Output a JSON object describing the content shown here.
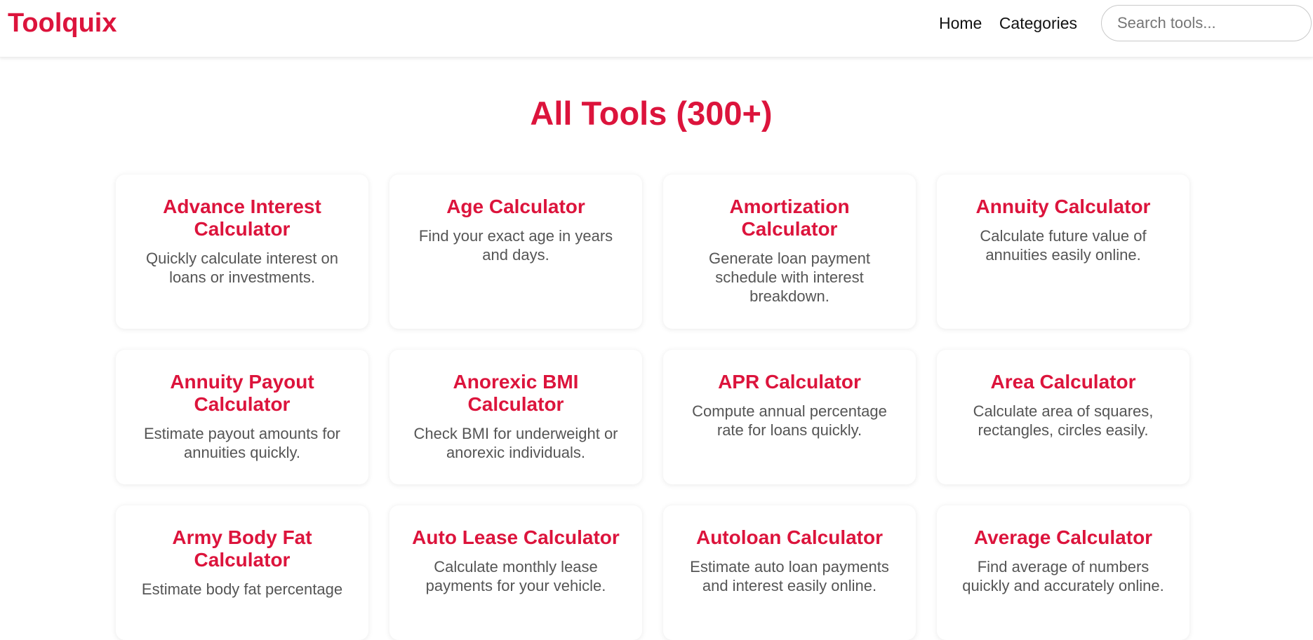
{
  "header": {
    "logo": "Toolquix",
    "nav": [
      {
        "label": "Home"
      },
      {
        "label": "Categories"
      }
    ],
    "search": {
      "placeholder": "Search tools...",
      "value": ""
    }
  },
  "main": {
    "title": "All Tools (300+)",
    "tools": [
      {
        "title": "Advance Interest Calculator",
        "desc": "Quickly calculate interest on loans or investments."
      },
      {
        "title": "Age Calculator",
        "desc": "Find your exact age in years and days."
      },
      {
        "title": "Amortization Calculator",
        "desc": "Generate loan payment schedule with interest breakdown."
      },
      {
        "title": "Annuity Calculator",
        "desc": "Calculate future value of annuities easily online."
      },
      {
        "title": "Annuity Payout Calculator",
        "desc": "Estimate payout amounts for annuities quickly."
      },
      {
        "title": "Anorexic BMI Calculator",
        "desc": "Check BMI for underweight or anorexic individuals."
      },
      {
        "title": "APR Calculator",
        "desc": "Compute annual percentage rate for loans quickly."
      },
      {
        "title": "Area Calculator",
        "desc": "Calculate area of squares, rectangles, circles easily."
      },
      {
        "title": "Army Body Fat Calculator",
        "desc": "Estimate body fat percentage"
      },
      {
        "title": "Auto Lease Calculator",
        "desc": "Calculate monthly lease payments for your vehicle."
      },
      {
        "title": "Autoloan Calculator",
        "desc": "Estimate auto loan payments and interest easily online."
      },
      {
        "title": "Average Calculator",
        "desc": "Find average of numbers quickly and accurately online."
      }
    ]
  },
  "colors": {
    "accent": "#dc143c",
    "text": "#555555",
    "background": "#ffffff"
  }
}
